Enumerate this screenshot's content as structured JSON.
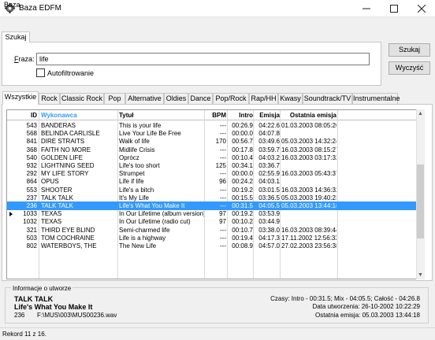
{
  "window": {
    "title": "Baza EDFM"
  },
  "menu": {
    "items": [
      "Baza"
    ]
  },
  "search": {
    "tab_label": "Szukaj",
    "fraza_label": "Fraza:",
    "fraza_value": "life",
    "autofilter_label": "Autofiltrowanie",
    "autofilter_checked": false,
    "search_button": "Szukaj",
    "clear_button": "Wyczyść"
  },
  "tabs": [
    "Wszystkie",
    "Rock",
    "Classic Rock",
    "Pop",
    "Alternative",
    "Oldies",
    "Dance",
    "Pop/Rock",
    "Rap/HH",
    "Kwasy",
    "Soundtrack/TV",
    "Instrumentalne"
  ],
  "active_tab": "Wszystkie",
  "grid": {
    "columns": [
      "ID",
      "Wykonawca",
      "Tytuł",
      "BPM",
      "Intro",
      "Emisja",
      "Ostatnia emisja"
    ],
    "sorted_column_color": "#3399ff",
    "rows": [
      [
        "543",
        "BANDERAS",
        "This is your life",
        "---",
        "00:26.9",
        "04:22.6",
        "01.03.2003 08:05:26"
      ],
      [
        "568",
        "BELINDA CARLISLE",
        "Live Your Life Be Free",
        "---",
        "00:00.0",
        "04:07.8",
        ""
      ],
      [
        "841",
        "DIRE STRAITS",
        "Walk of life",
        "170",
        "00:56.7",
        "03:49.6",
        "05.03.2003 14:32:24"
      ],
      [
        "368",
        "FAITH NO MORE",
        "Midlife Crisis",
        "---",
        "00:17.8",
        "03:59.7",
        "16.03.2003 08:15:27"
      ],
      [
        "540",
        "GOLDEN LIFE",
        "Oprócz",
        "---",
        "00:10.4",
        "04:03.2",
        "16.03.2003 03:17:32"
      ],
      [
        "932",
        "LIGHTNING SEED",
        "Life's too short",
        "125",
        "00:34.1",
        "03:36.7",
        ""
      ],
      [
        "292",
        "MY LIFE STORY",
        "Strumpet",
        "---",
        "00:00.0",
        "02:55.9",
        "16.03.2003 05:43:37"
      ],
      [
        "864",
        "OPUS",
        "Life if life",
        "96",
        "00:24.2",
        "04:03.1",
        ""
      ],
      [
        "553",
        "SHOOTER",
        "Life's a bitch",
        "---",
        "00:19.2",
        "03:01.5",
        "16.03.2003 14:36:32"
      ],
      [
        "237",
        "TALK TALK",
        "It's My Life",
        "---",
        "00:15.5",
        "03:36.5",
        "05.03.2003 19:40:23"
      ],
      [
        "236",
        "TALK TALK",
        "Life's What You Make It",
        "---",
        "00:31.5",
        "04:05.5",
        "05.03.2003 13:44:18"
      ],
      [
        "1033",
        "TEXAS",
        "In Our Lifetime (album version)",
        "97",
        "00:19.2",
        "03:53.9",
        ""
      ],
      [
        "1032",
        "TEXAS",
        "In Our Lifetime (radio cut)",
        "97",
        "00:10.2",
        "03:44.9",
        ""
      ],
      [
        "321",
        "THIRD EYE BLIND",
        "Semi-charmed life",
        "---",
        "00:10.7",
        "03:38.0",
        "16.03.2003 08:39:44"
      ],
      [
        "503",
        "TOM COCHRAINE",
        "Life is a highway",
        "---",
        "00:19.4",
        "04:17.3",
        "17.11.2002 12:56:33"
      ],
      [
        "802",
        "WATERBOYS, THE",
        "The New Life",
        "---",
        "00:08.9",
        "04:57.0",
        "27.02.2003 23:56:38"
      ]
    ],
    "selected_row": 10
  },
  "info": {
    "title": "Informacje o utworze",
    "artist": "TALK TALK",
    "song": "Life's What You Make It",
    "id": "236",
    "path": "F:\\MUS\\003\\MUS00236.wav",
    "times": "Czasy: Intro - 00:31.5;  Mix - 04:05.5;  Całość - 04:26.8",
    "created": "Data utworzenia: 26-10-2002 10:22:29",
    "last_played": "Ostatnia emisja: 05.03.2003 13:44:18"
  },
  "status": {
    "text": "Rekord 11 z 16."
  }
}
